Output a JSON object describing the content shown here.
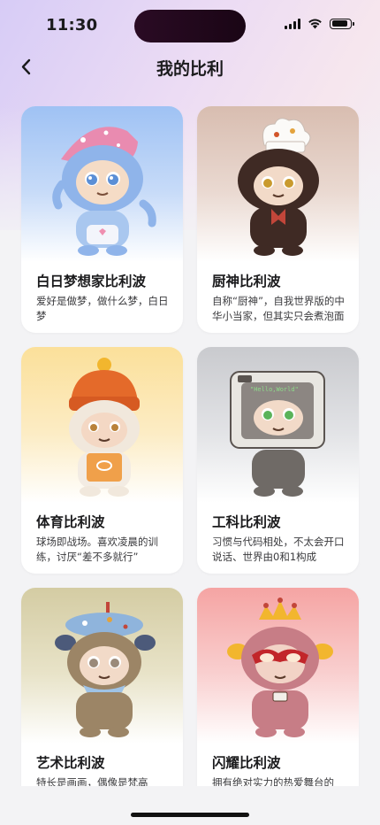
{
  "status_bar": {
    "time": "11:30"
  },
  "nav": {
    "title": "我的比利",
    "back_icon": "chevron-left-icon"
  },
  "cards": [
    {
      "name": "白日梦想家比利波",
      "desc": "爱好是做梦，做什么梦，白日梦",
      "bg_color": "#a9c8f5"
    },
    {
      "name": "厨神比利波",
      "desc": "自称“厨神”，自我世界版的中华小当家，但其实只会煮泡面",
      "bg_color": "#d8bfb3"
    },
    {
      "name": "体育比利波",
      "desc": "球场即战场。喜欢凌晨的训练，讨厌“差不多就行”",
      "bg_color": "#fbe3a3"
    },
    {
      "name": "工科比利波",
      "desc": "习惯与代码相处，不太会开口说话、世界由0和1构成",
      "bg_color": "#cdced2"
    },
    {
      "name": "艺术比利波",
      "desc": "特长是画画，偶像是梵高",
      "bg_color": "#d6cfa9"
    },
    {
      "name": "闪耀比利波",
      "desc": "拥有绝对实力的热爱舞台的",
      "bg_color": "#f6a9a8"
    }
  ]
}
